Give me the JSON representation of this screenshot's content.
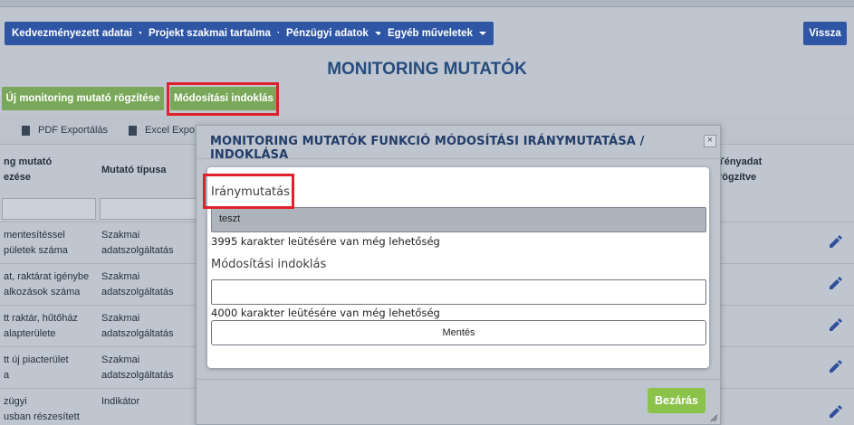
{
  "nav": {
    "items": [
      {
        "label": "Kedvezményezett adatai"
      },
      {
        "label": "Projekt szakmai tartalma"
      },
      {
        "label": "Pénzügyi adatok"
      },
      {
        "label": "Egyéb műveletek"
      }
    ],
    "back_label": "Vissza"
  },
  "page": {
    "title": "MONITORING MUTATÓK",
    "new_indicator_label": "Új monitoring mutató rögzítése",
    "justify_label": "Módosítási indoklás"
  },
  "table": {
    "export_pdf": "PDF Exportálás",
    "export_excel": "Excel Expo",
    "headers": {
      "name_line1": "ng mutató",
      "name_line2": "ezése",
      "type": "Mutató típusa",
      "actual_line1": "Tényadat",
      "actual_line2": "rögzítve"
    },
    "rows": [
      {
        "name1": "mentesítéssel",
        "name2": "pületek száma",
        "type1": "Szakmai",
        "type2": "adatszolgáltatás"
      },
      {
        "name1": "at, raktárat igénybe",
        "name2": "alkozások száma",
        "type1": "Szakmai",
        "type2": "adatszolgáltatás"
      },
      {
        "name1": "tt raktár, hűtőház",
        "name2": "alapterülete",
        "type1": "Szakmai",
        "type2": "adatszolgáltatás"
      },
      {
        "name1": "tt új piacterület",
        "name2": "a",
        "type1": "Szakmai",
        "type2": "adatszolgáltatás"
      },
      {
        "name1": "zügyi",
        "name2": "usban részesített",
        "type1": "",
        "type2": "Indikátor"
      }
    ]
  },
  "modal": {
    "title": "MONITORING MUTATÓK FUNKCIÓ MÓDOSÍTÁSI IRÁNYMUTATÁSA / INDOKLÁSA",
    "close_symbol": "×",
    "guidance_label": "Iránymutatás",
    "guidance_value": "teszt",
    "guidance_hint": "3995 karakter leütésére van még lehetőség",
    "reason_label": "Módosítási indoklás",
    "reason_value": "",
    "reason_hint": "4000 karakter leütésére van még lehetőség",
    "save_label": "Mentés",
    "close_label": "Bezárás"
  },
  "colors": {
    "nav_blue": "#2f56a4",
    "title_blue": "#264b7e",
    "green": "#7aa85a",
    "close_green": "#8bc34a",
    "highlight_red": "#e0202a"
  },
  "icons": [
    "caret-down-icon",
    "pdf-file-icon",
    "excel-file-icon",
    "close-icon",
    "edit-pencil-icon",
    "resize-grip-icon"
  ]
}
